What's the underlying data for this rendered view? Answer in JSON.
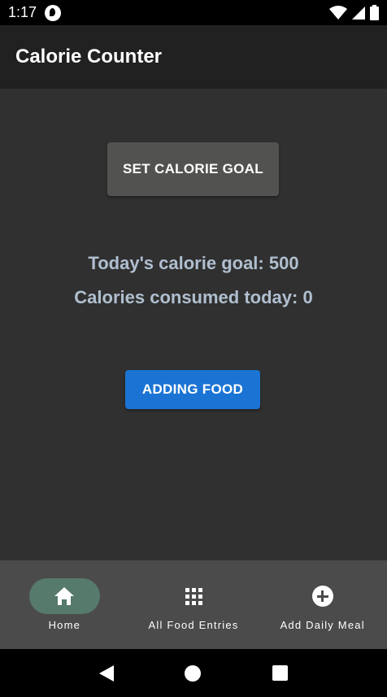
{
  "status_bar": {
    "time": "1:17",
    "icons": [
      "app-notification-icon",
      "wifi-icon",
      "signal-icon",
      "battery-icon"
    ]
  },
  "toolbar": {
    "title": "Calorie Counter"
  },
  "main": {
    "set_goal_label": "SET CALORIE GOAL",
    "goal_text": "Today's calorie goal: 500",
    "consumed_text": "Calories consumed today: 0",
    "add_food_label": "ADDING FOOD"
  },
  "bottom_nav": {
    "items": [
      {
        "label": "Home",
        "icon": "home-icon",
        "active": true
      },
      {
        "label": "All Food Entries",
        "icon": "grid-icon",
        "active": false
      },
      {
        "label": "Add Daily Meal",
        "icon": "add-circle-icon",
        "active": false
      }
    ]
  },
  "system_nav": {
    "icons": [
      "back-icon",
      "home-circle-icon",
      "recents-icon"
    ]
  },
  "colors": {
    "background": "#303030",
    "toolbar": "#212121",
    "accent_blue": "#1b74d4",
    "stat_text": "#b0bfcf",
    "nav_active_pill": "#567a6c",
    "bottom_nav": "#4b4b4b"
  }
}
